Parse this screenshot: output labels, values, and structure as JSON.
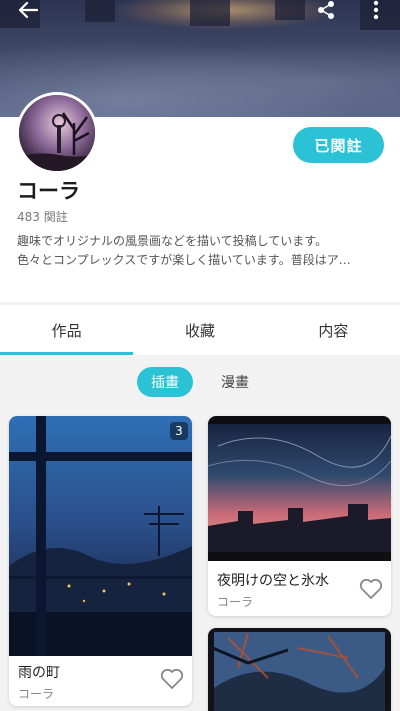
{
  "header": {
    "back_icon": "arrow-left-icon",
    "share_icon": "share-icon",
    "more_icon": "more-vert-icon"
  },
  "profile": {
    "name": "コーラ",
    "follows": "483 関註",
    "bio": "趣味でオリジナルの風景画などを描いて投稿しています。\n色々とコンプレックスですが楽しく描いています。普段はア…",
    "follow_button": "已関註"
  },
  "tabs": [
    {
      "label": "作品",
      "active": true
    },
    {
      "label": "收藏",
      "active": false
    },
    {
      "label": "内容",
      "active": false
    }
  ],
  "subtabs": [
    {
      "label": "插畫",
      "active": true
    },
    {
      "label": "漫畫",
      "active": false
    }
  ],
  "works": [
    {
      "title": "雨の町",
      "author": "コーラ",
      "page_count": "3"
    },
    {
      "title": "夜明けの空と氷水",
      "author": "コーラ",
      "page_count": ""
    },
    {
      "title": "",
      "author": "",
      "page_count": ""
    }
  ],
  "colors": {
    "accent": "#2cc2d6"
  }
}
